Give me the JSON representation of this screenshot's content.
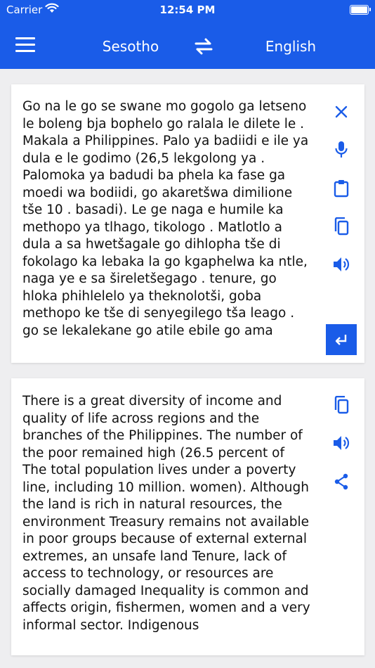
{
  "status_bar": {
    "carrier": "Carrier",
    "time": "12:54 PM"
  },
  "header": {
    "source_language": "Sesotho",
    "target_language": "English"
  },
  "source_panel": {
    "text": "Go na le go se swane mo gogolo ga letseno le boleng bja bophelo go ralala le dilete le . Makala a Philippines. Palo ya badiidi e ile ya dula e le godimo (26,5 lekgolong ya . Palomoka ya badudi ba phela ka fase ga moedi wa bodiidi, go akaretšwa dimilione tše 10 . basadi). Le ge naga e humile ka methopo ya tlhago, tikologo . Matlotlo a dula a sa hwetšagale go dihlopha tše di fokolago ka lebaka la go kgaphelwa ka ntle, naga ye e sa šireletšegago . tenure, go hloka phihlelelo ya theknolotši, goba methopo ke tše di senyegilego tša leago . go se lekalekane go atile ebile go ama"
  },
  "target_panel": {
    "text": "There is a great diversity of income and quality of life across regions and the branches of the Philippines. The number of the poor remained high (26.5 percent of The total population lives under a poverty line, including 10 million. women). Although the land is rich in natural resources, the environment Treasury remains not available in poor groups because of external external extremes, an unsafe land Tenure, lack of access to technology, or resources are socially damaged Inequality is common and affects origin, fishermen, women and a very informal sector. Indigenous"
  },
  "colors": {
    "accent": "#1a5ce8",
    "background": "#eeeef0",
    "card": "#ffffff",
    "text": "#111111"
  },
  "icons": [
    "menu-icon",
    "swap-icon",
    "close-icon",
    "microphone-icon",
    "clipboard-icon",
    "copy-icon",
    "speaker-icon",
    "enter-icon",
    "share-icon"
  ]
}
